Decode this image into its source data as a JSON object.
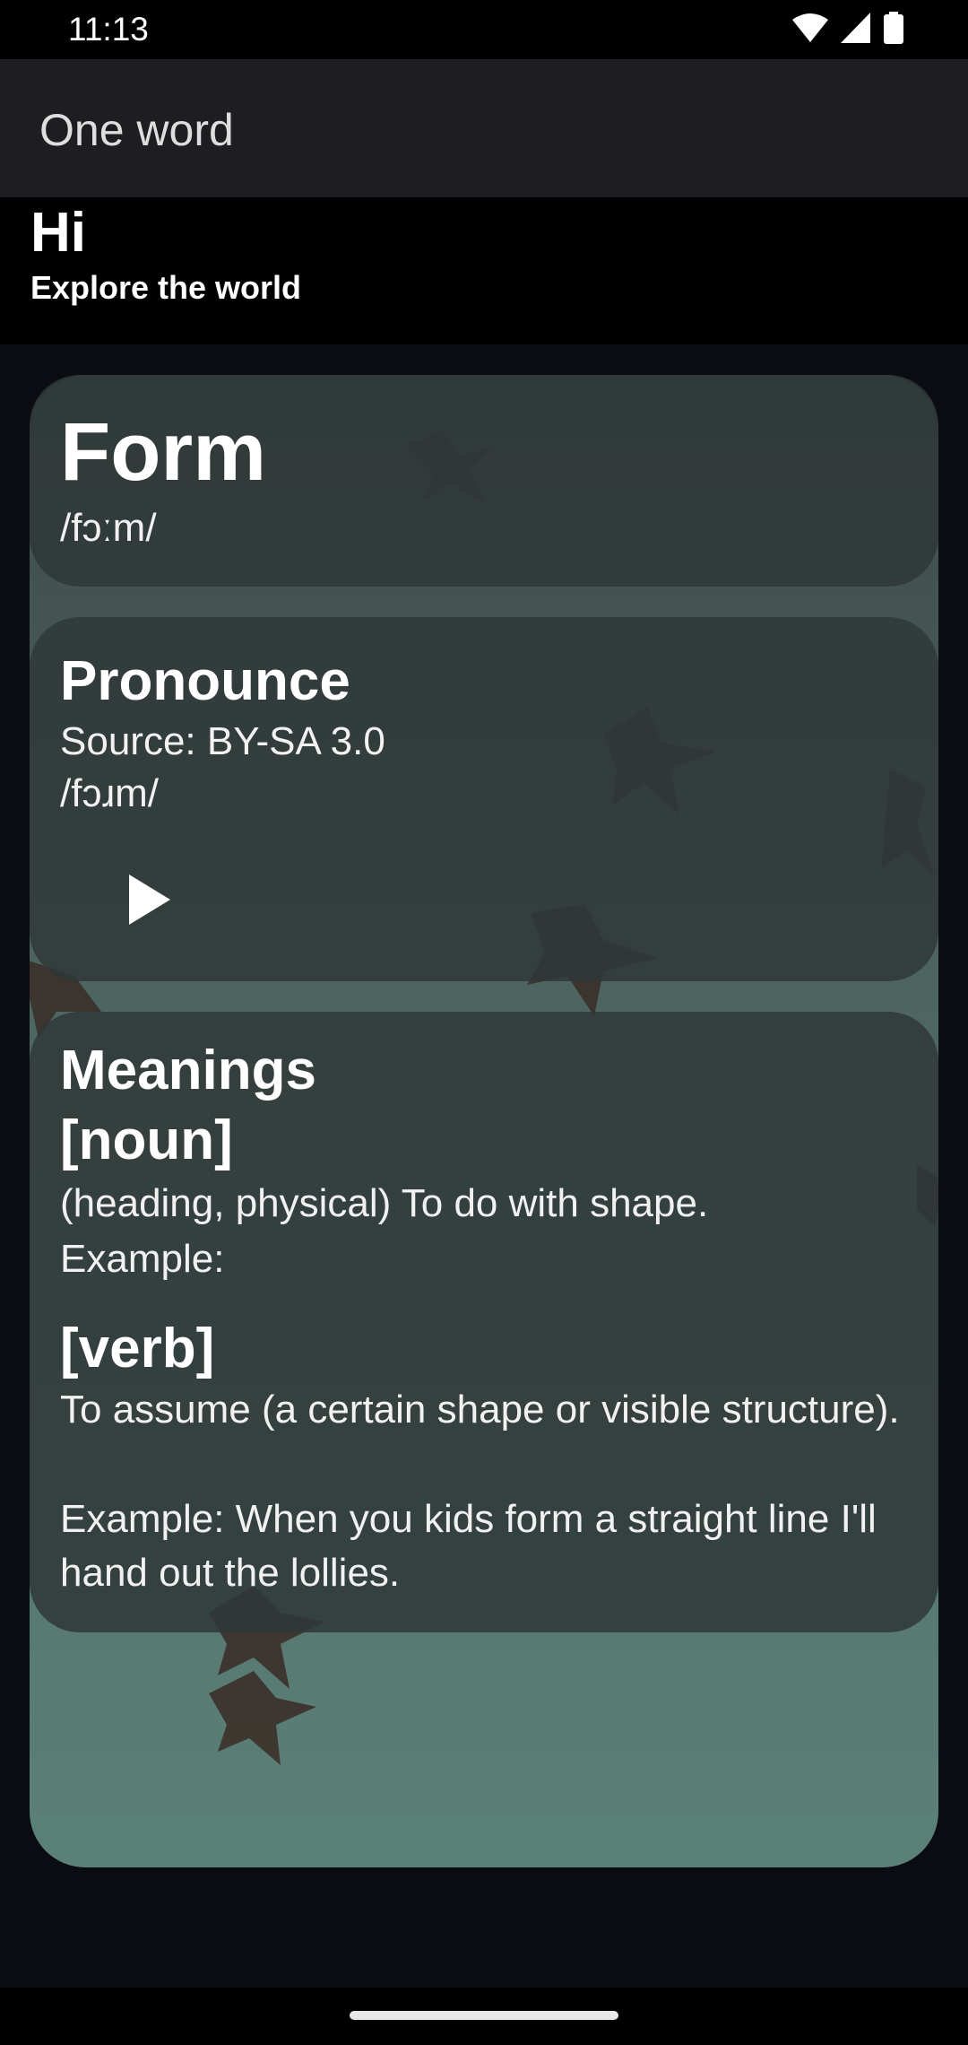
{
  "status_bar": {
    "time": "11:13",
    "icons": [
      "wifi-icon",
      "signal-icon",
      "battery-icon"
    ]
  },
  "app_bar": {
    "title": "One word"
  },
  "greeting": {
    "title": "Hi",
    "subtitle": "Explore the world"
  },
  "word_card": {
    "word": "Form",
    "phonetic": "/fɔːm/"
  },
  "pronounce_card": {
    "heading": "Pronounce",
    "source": "Source: BY-SA 3.0",
    "phonetic": "/fɔɹm/",
    "play_icon": "play-icon"
  },
  "meanings_card": {
    "heading": "Meanings",
    "entries": [
      {
        "part_of_speech": "[noun]",
        "definition": "(heading, physical) To do with shape.",
        "example": "Example:"
      },
      {
        "part_of_speech": "[verb]",
        "definition": "To assume (a certain shape or visible structure).",
        "example": "Example: When you kids form a straight line I'll hand out the lollies."
      }
    ]
  },
  "colors": {
    "background": "#0b0b12",
    "app_bar": "#1d1d22",
    "card": "#303838",
    "text": "#ffffff"
  }
}
